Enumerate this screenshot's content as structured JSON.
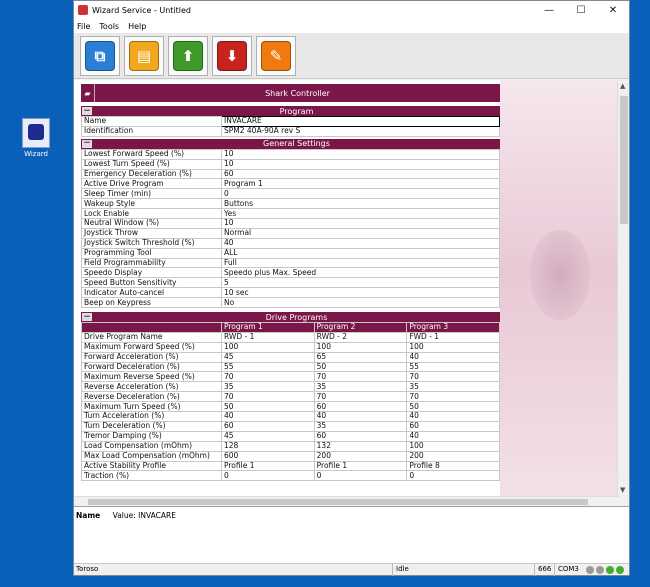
{
  "desktop": {
    "icon_label": "Wizard"
  },
  "window": {
    "title": "Wizard Service - Untitled",
    "min": "—",
    "max": "☐",
    "close": "✕"
  },
  "menu": [
    "File",
    "Tools",
    "Help"
  ],
  "toolbar_icons": [
    {
      "name": "open-file",
      "color": "#2a7fd4",
      "glyph": "⧉"
    },
    {
      "name": "program",
      "color": "#f2a81c",
      "glyph": "▤"
    },
    {
      "name": "read-chair",
      "color": "#3e9a2a",
      "glyph": "⬆"
    },
    {
      "name": "write-chair",
      "color": "#c8241c",
      "glyph": "⬇"
    },
    {
      "name": "tools",
      "color": "#f07a10",
      "glyph": "✎"
    }
  ],
  "controller_title": "Shark Controller",
  "program": {
    "header": "Program",
    "rows": [
      {
        "k": "Name",
        "v": "INVACARE"
      },
      {
        "k": "Identification",
        "v": "SPM2 40A-90A rev S"
      }
    ]
  },
  "general_settings": {
    "header": "General Settings",
    "rows": [
      {
        "k": "Lowest Forward Speed (%)",
        "v": "10"
      },
      {
        "k": "Lowest Turn Speed (%)",
        "v": "10"
      },
      {
        "k": "Emergency Deceleration (%)",
        "v": "60"
      },
      {
        "k": "Active Drive Program",
        "v": "Program 1"
      },
      {
        "k": "Sleep Timer (min)",
        "v": "0"
      },
      {
        "k": "Wakeup Style",
        "v": "Buttons"
      },
      {
        "k": "Lock Enable",
        "v": "Yes"
      },
      {
        "k": "Neutral Window (%)",
        "v": "10"
      },
      {
        "k": "Joystick Throw",
        "v": "Normal"
      },
      {
        "k": "Joystick Switch Threshold (%)",
        "v": "40"
      },
      {
        "k": "Programming Tool",
        "v": "ALL"
      },
      {
        "k": "Field Programmability",
        "v": "Full"
      },
      {
        "k": "Speedo Display",
        "v": "Speedo plus Max. Speed"
      },
      {
        "k": "Speed Button Sensitivity",
        "v": "5"
      },
      {
        "k": "Indicator Auto-cancel",
        "v": "10 sec"
      },
      {
        "k": "Beep on Keypress",
        "v": "No"
      }
    ]
  },
  "drive_programs": {
    "header": "Drive Programs",
    "columns": [
      "Program 1",
      "Program 2",
      "Program 3"
    ],
    "rows": [
      {
        "k": "Drive Program Name",
        "v": [
          "RWD - 1",
          "RWD - 2",
          "FWD - 1"
        ]
      },
      {
        "k": "Maximum Forward Speed (%)",
        "v": [
          "100",
          "100",
          "100"
        ]
      },
      {
        "k": "Forward Acceleration (%)",
        "v": [
          "45",
          "65",
          "40"
        ]
      },
      {
        "k": "Forward Deceleration (%)",
        "v": [
          "55",
          "50",
          "55"
        ]
      },
      {
        "k": "Maximum Reverse Speed (%)",
        "v": [
          "70",
          "70",
          "70"
        ]
      },
      {
        "k": "Reverse Acceleration (%)",
        "v": [
          "35",
          "35",
          "35"
        ]
      },
      {
        "k": "Reverse Deceleration (%)",
        "v": [
          "70",
          "70",
          "70"
        ]
      },
      {
        "k": "Maximum Turn Speed (%)",
        "v": [
          "50",
          "60",
          "50"
        ]
      },
      {
        "k": "Turn Acceleration (%)",
        "v": [
          "40",
          "40",
          "40"
        ]
      },
      {
        "k": "Turn Deceleration (%)",
        "v": [
          "60",
          "35",
          "60"
        ]
      },
      {
        "k": "Tremor Damping (%)",
        "v": [
          "45",
          "60",
          "40"
        ]
      },
      {
        "k": "Load Compensation (mOhm)",
        "v": [
          "128",
          "132",
          "100"
        ]
      },
      {
        "k": "Max Load Compensation (mOhm)",
        "v": [
          "600",
          "200",
          "200"
        ]
      },
      {
        "k": "Active Stability Profile",
        "v": [
          "Profile 1",
          "Profile 1",
          "Profile 8"
        ]
      },
      {
        "k": "Traction (%)",
        "v": [
          "0",
          "0",
          "0"
        ]
      }
    ]
  },
  "description": {
    "label": "Name",
    "text": "Value: INVACARE"
  },
  "status": {
    "left": "Toroso",
    "mid": "Idle",
    "code": "666",
    "port": "COM3"
  },
  "leds": [
    "#9a9a9a",
    "#9a9a9a",
    "#3fae2a",
    "#3fae2a"
  ]
}
